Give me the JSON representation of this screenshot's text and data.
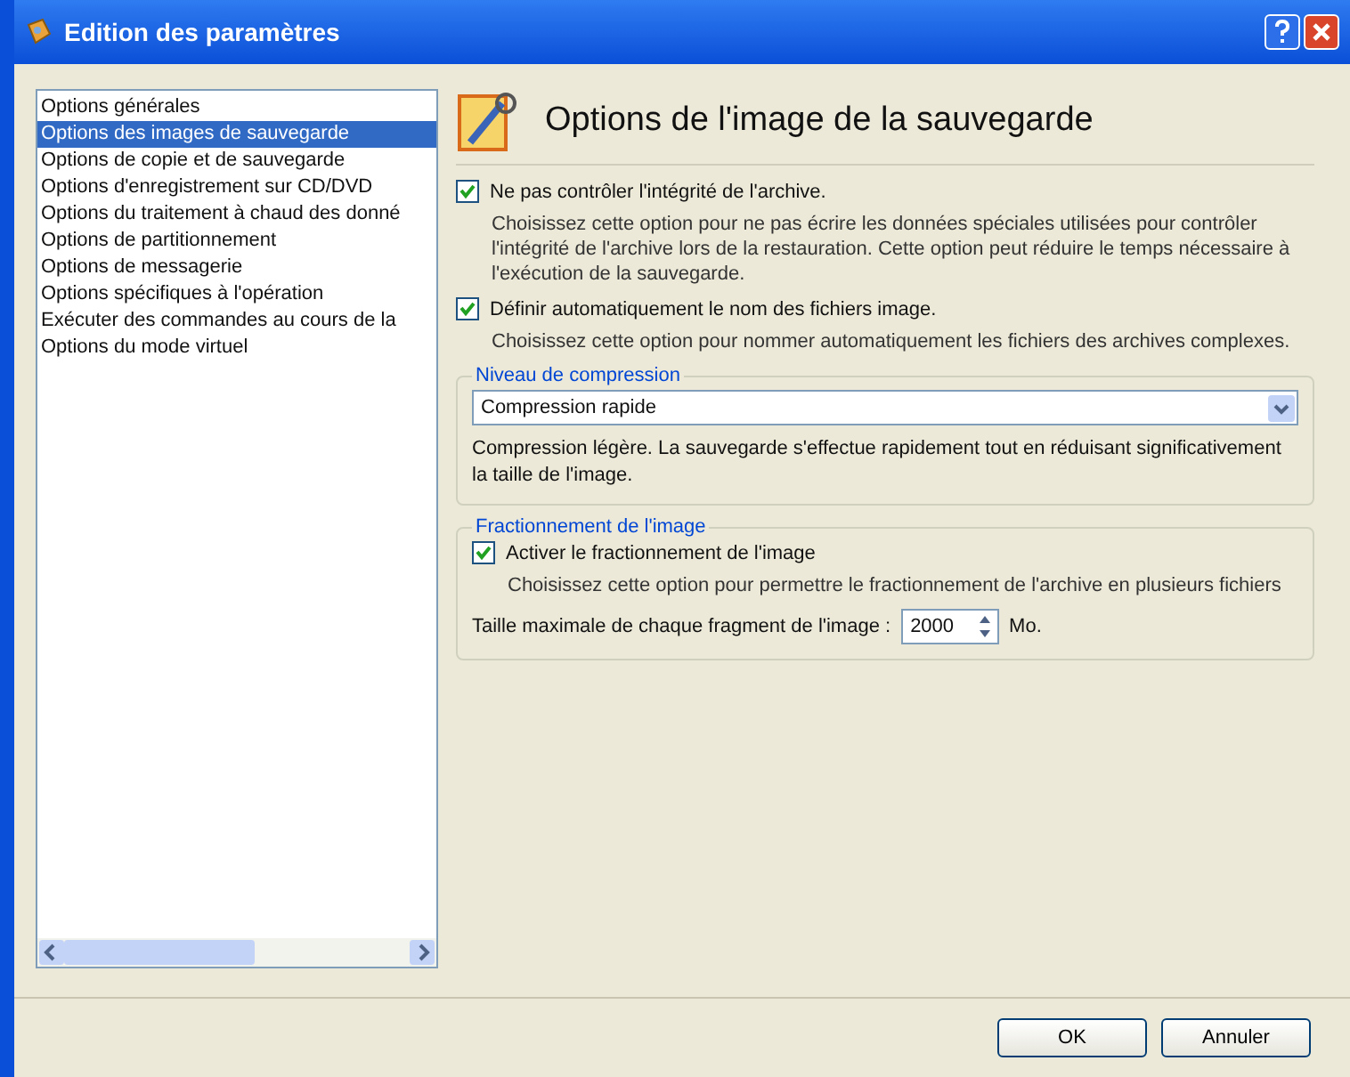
{
  "window": {
    "title": "Edition des paramètres"
  },
  "sidebar": {
    "items": [
      {
        "label": "Options générales",
        "selected": false
      },
      {
        "label": "Options des images de sauvegarde",
        "selected": true
      },
      {
        "label": "Options de copie et de sauvegarde",
        "selected": false
      },
      {
        "label": "Options d'enregistrement sur CD/DVD",
        "selected": false
      },
      {
        "label": "Options du traitement à chaud des donné",
        "selected": false
      },
      {
        "label": "Options de partitionnement",
        "selected": false
      },
      {
        "label": "Options de messagerie",
        "selected": false
      },
      {
        "label": "Options spécifiques à l'opération",
        "selected": false
      },
      {
        "label": "Exécuter des commandes au cours de la",
        "selected": false
      },
      {
        "label": "Options du mode virtuel",
        "selected": false
      }
    ]
  },
  "panel": {
    "title": "Options de l'image de la sauvegarde",
    "options": [
      {
        "label": "Ne pas contrôler l'intégrité de l'archive.",
        "checked": true,
        "description": "Choisissez cette option pour ne pas écrire les données spéciales utilisées pour contrôler l'intégrité de l'archive lors de la restauration. Cette option peut réduire le temps nécessaire à l'exécution de la sauvegarde."
      },
      {
        "label": "Définir automatiquement le nom des fichiers image.",
        "checked": true,
        "description": "Choisissez cette option pour nommer automatiquement les fichiers des archives complexes."
      }
    ],
    "compression": {
      "legend": "Niveau de compression",
      "value": "Compression rapide",
      "description": "Compression légère. La sauvegarde s'effectue rapidement tout en réduisant significativement la taille de l'image."
    },
    "splitting": {
      "legend": "Fractionnement de l'image",
      "option": {
        "label": "Activer le fractionnement de l'image",
        "checked": true,
        "description": "Choisissez cette option pour permettre le fractionnement de l'archive en plusieurs fichiers"
      },
      "size_label": "Taille maximale de chaque fragment de l'image :",
      "size_value": "2000",
      "unit": "Mo."
    }
  },
  "buttons": [
    {
      "label": "OK"
    },
    {
      "label": "Annuler"
    }
  ]
}
